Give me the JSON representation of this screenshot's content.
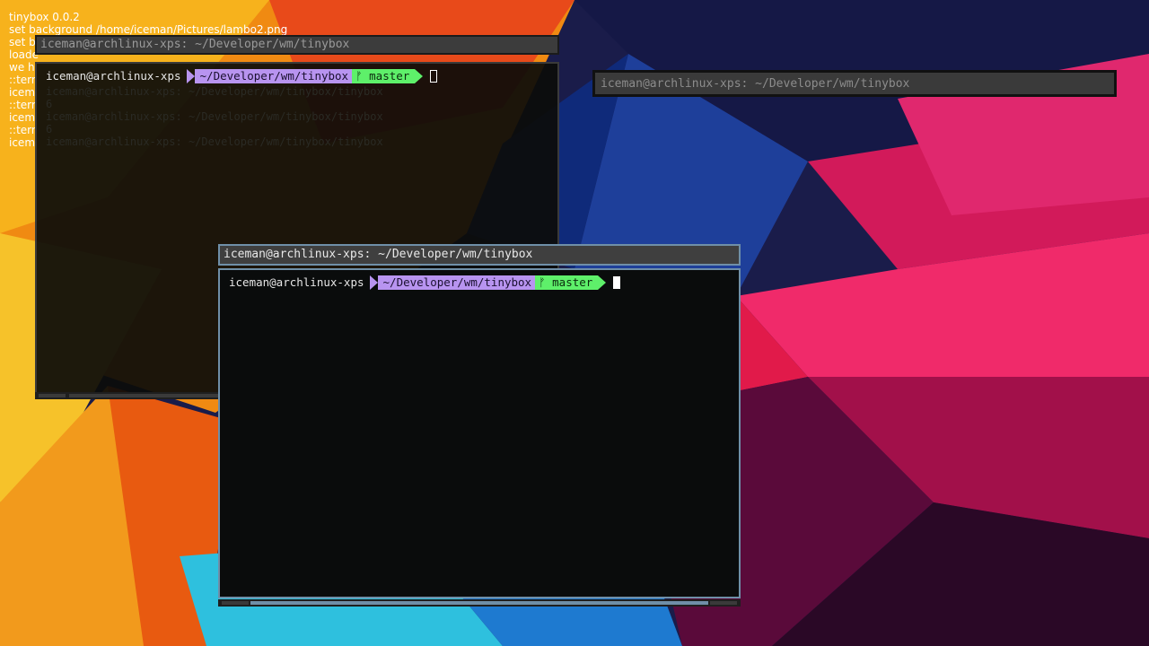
{
  "desktop_log": [
    "tinybox 0.0.2",
    "set background /home/iceman/Pictures/lambo2.png",
    "set b",
    "loade",
    "we h",
    "::terr",
    "icem",
    "::terr",
    "icem",
    "::terr",
    "icem"
  ],
  "windows": {
    "back": {
      "title": "iceman@archlinux-xps: ~/Developer/wm/tinybox",
      "prompt": {
        "user": "iceman@archlinux-xps",
        "path": "~/Developer/wm/tinybox",
        "branch_icon": "ᚠ",
        "branch": "master"
      },
      "faint_lines": [
        "iceman@archlinux-xps: ~/Developer/wm/tinybox/tinybox",
        "6",
        "iceman@archlinux-xps: ~/Developer/wm/tinybox/tinybox",
        "6",
        "iceman@archlinux-xps: ~/Developer/wm/tinybox/tinybox"
      ]
    },
    "shaded": {
      "title": "iceman@archlinux-xps: ~/Developer/wm/tinybox"
    },
    "front": {
      "title": "iceman@archlinux-xps: ~/Developer/wm/tinybox",
      "prompt": {
        "user": "iceman@archlinux-xps",
        "path": "~/Developer/wm/tinybox",
        "branch_icon": "ᚠ",
        "branch": "master"
      }
    }
  },
  "colors": {
    "focus_border": "#6f8fa8",
    "prompt_path_bg": "#b894f0",
    "prompt_branch_bg": "#5ef06a"
  }
}
